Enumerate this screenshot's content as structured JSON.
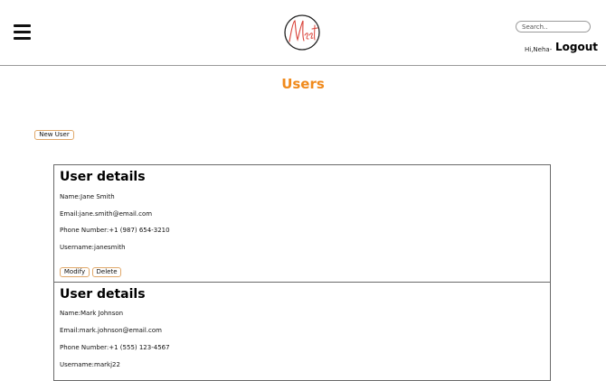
{
  "header": {
    "search_placeholder": "Search..",
    "greeting": "Hi,Neha-",
    "logout_label": "Logout",
    "logo_text": "Meet"
  },
  "page": {
    "title": "Users",
    "new_user_label": "New User"
  },
  "labels": {
    "name": "Name:",
    "email": "Email:",
    "phone": "Phone Number:",
    "username": "Username:"
  },
  "users": [
    {
      "card_title": "User details",
      "name": "Jane Smith",
      "email": "jane.smith@email.com",
      "phone": "+1 (987) 654-3210",
      "username": "janesmith",
      "modify_label": "Modify",
      "delete_label": "Delete"
    },
    {
      "card_title": "User details",
      "name": "Mark Johnson",
      "email": "mark.johnson@email.com",
      "phone": "+1 (555) 123-4567",
      "username": "markj22"
    }
  ],
  "colors": {
    "accent": "#f08a1c",
    "logo_red": "#d9433a",
    "border": "#6a6a6a"
  }
}
